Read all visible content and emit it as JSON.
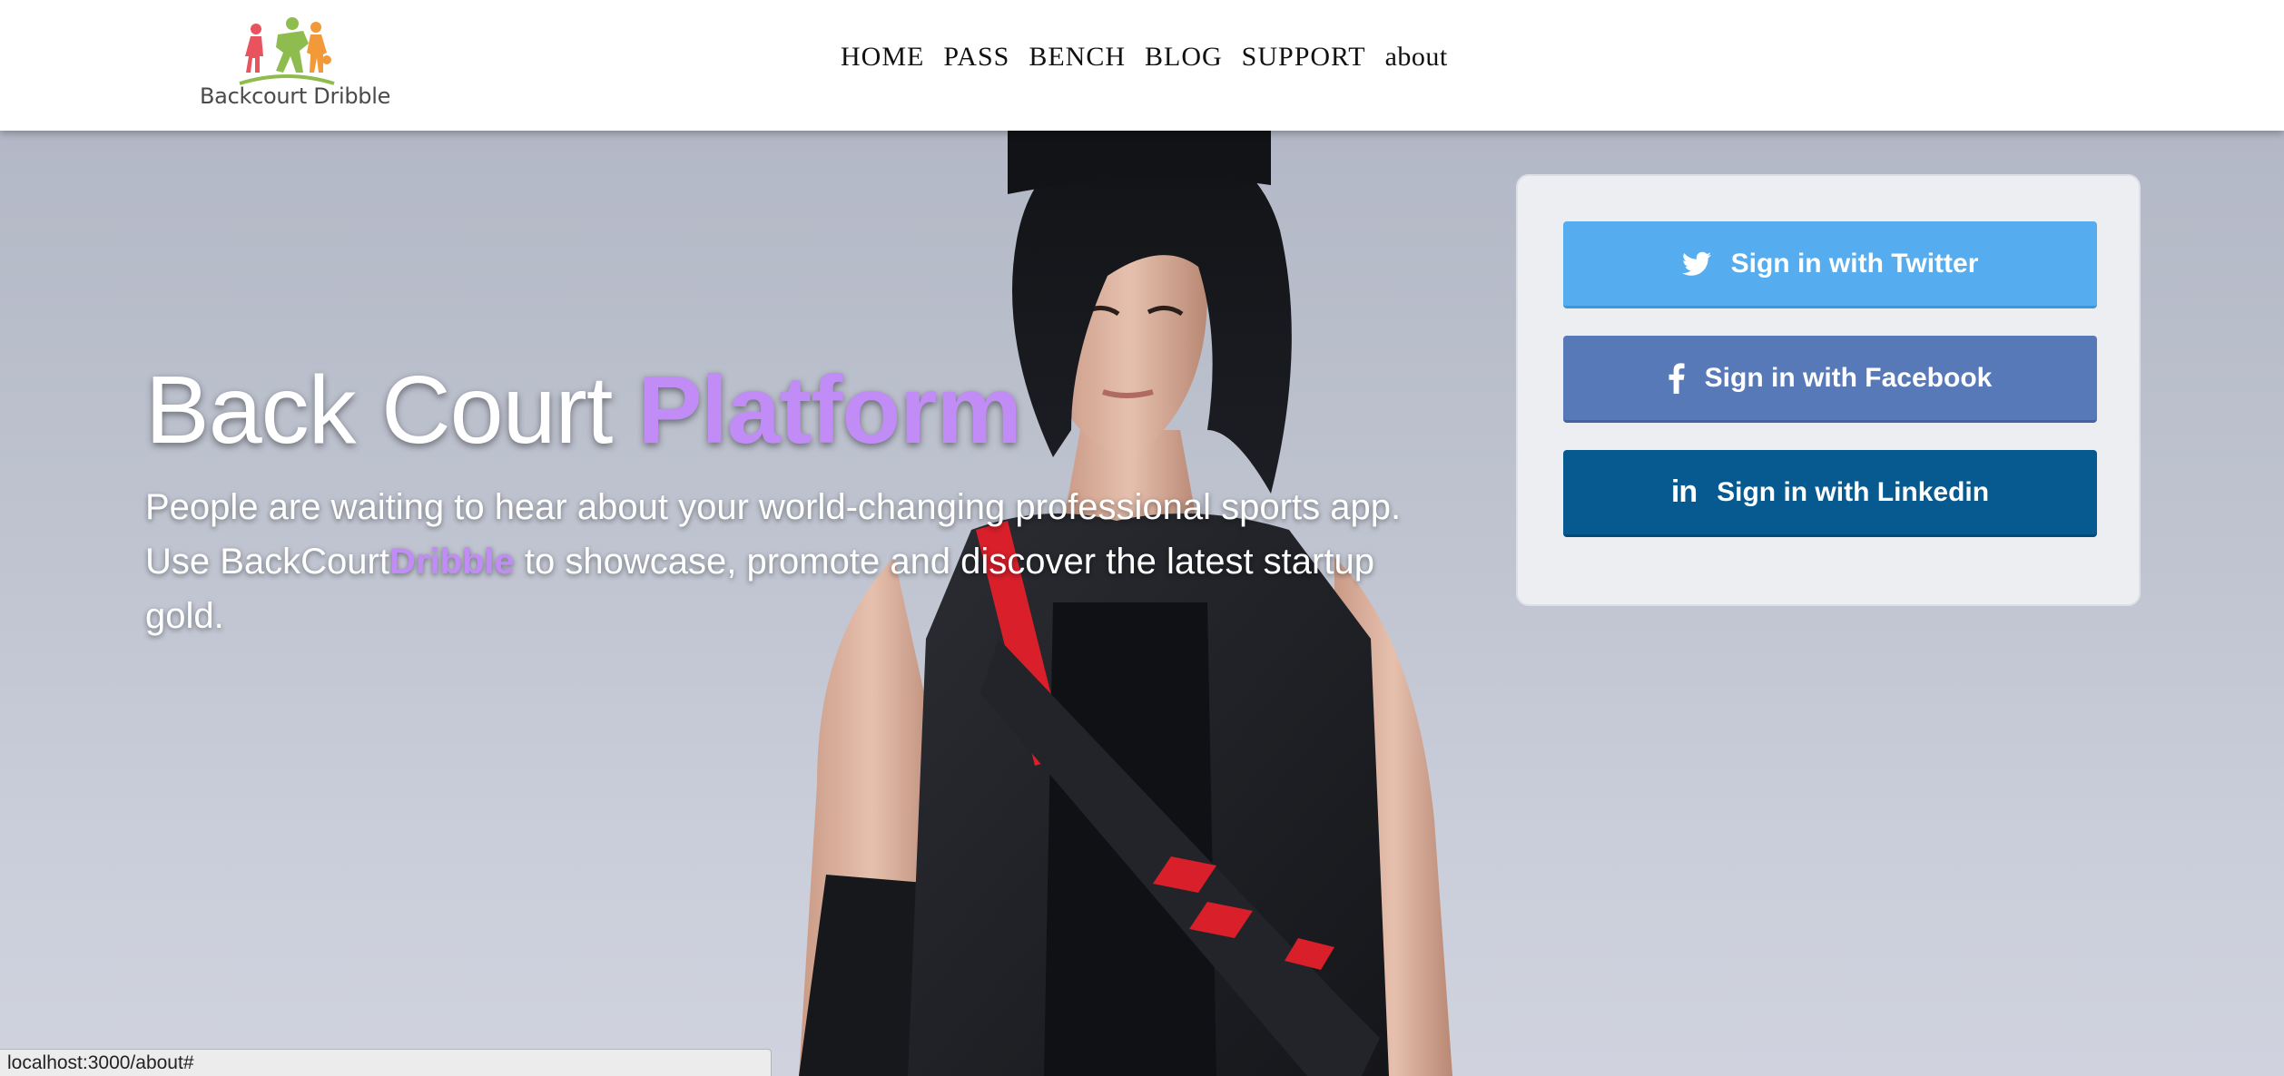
{
  "logo": {
    "text": "Backcourt Dribble",
    "icon": "sports-players-logo"
  },
  "nav": {
    "items": [
      {
        "label": "HOME"
      },
      {
        "label": "PASS"
      },
      {
        "label": "BENCH"
      },
      {
        "label": "BLOG"
      },
      {
        "label": "SUPPORT"
      },
      {
        "label": "about"
      }
    ]
  },
  "hero": {
    "title_main": "Back Court ",
    "title_accent": "Platform",
    "description_before": "People are waiting to hear about your world-changing professional sports app. Use BackCourt",
    "description_accent": "Dribble",
    "description_after": " to showcase, promote and discover the latest startup gold."
  },
  "signin": {
    "twitter_label": "Sign in with Twitter",
    "facebook_label": "Sign in with Facebook",
    "linkedin_label": "Sign in with Linkedin",
    "linkedin_icon_text": "in"
  },
  "status_bar": {
    "url": "localhost:3000/about#"
  },
  "colors": {
    "accent": "#c18cf6",
    "twitter": "#55acee",
    "facebook": "#5879b7",
    "linkedin": "#065a8f",
    "logo_red": "#e8535e",
    "logo_green": "#8fbc4e",
    "logo_orange": "#f29a3a"
  }
}
